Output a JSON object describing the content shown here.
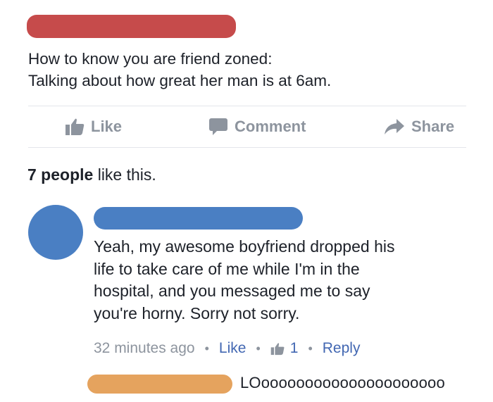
{
  "post": {
    "author_redaction_color": "#c64b4b",
    "text_lines": [
      "How to know you are friend zoned:",
      "Talking about how great her man is at 6am."
    ]
  },
  "actions": {
    "like_label": "Like",
    "comment_label": "Comment",
    "share_label": "Share",
    "like_icon": "thumbs-up-icon",
    "comment_icon": "speech-bubble-icon",
    "share_icon": "share-arrow-icon"
  },
  "likes_summary": {
    "count_text": "7 people",
    "suffix": "like this."
  },
  "comment": {
    "avatar_color": "#4a7fc3",
    "author_redaction_color": "#4a7fc3",
    "text_lines": [
      "Yeah, my awesome boyfriend dropped his",
      "life to take care of me while I'm in the",
      "hospital, and you messaged me to say",
      "you're horny. Sorry not sorry."
    ],
    "time": "32 minutes ago",
    "like_label": "Like",
    "like_count": "1",
    "reply_label": "Reply",
    "separator": "•"
  },
  "reply": {
    "author_redaction_color": "#e5a35e",
    "text": "LOooooooooooooooooooooo"
  },
  "colors": {
    "link": "#4267b2",
    "muted": "#8d949e",
    "text": "#1d2129"
  }
}
